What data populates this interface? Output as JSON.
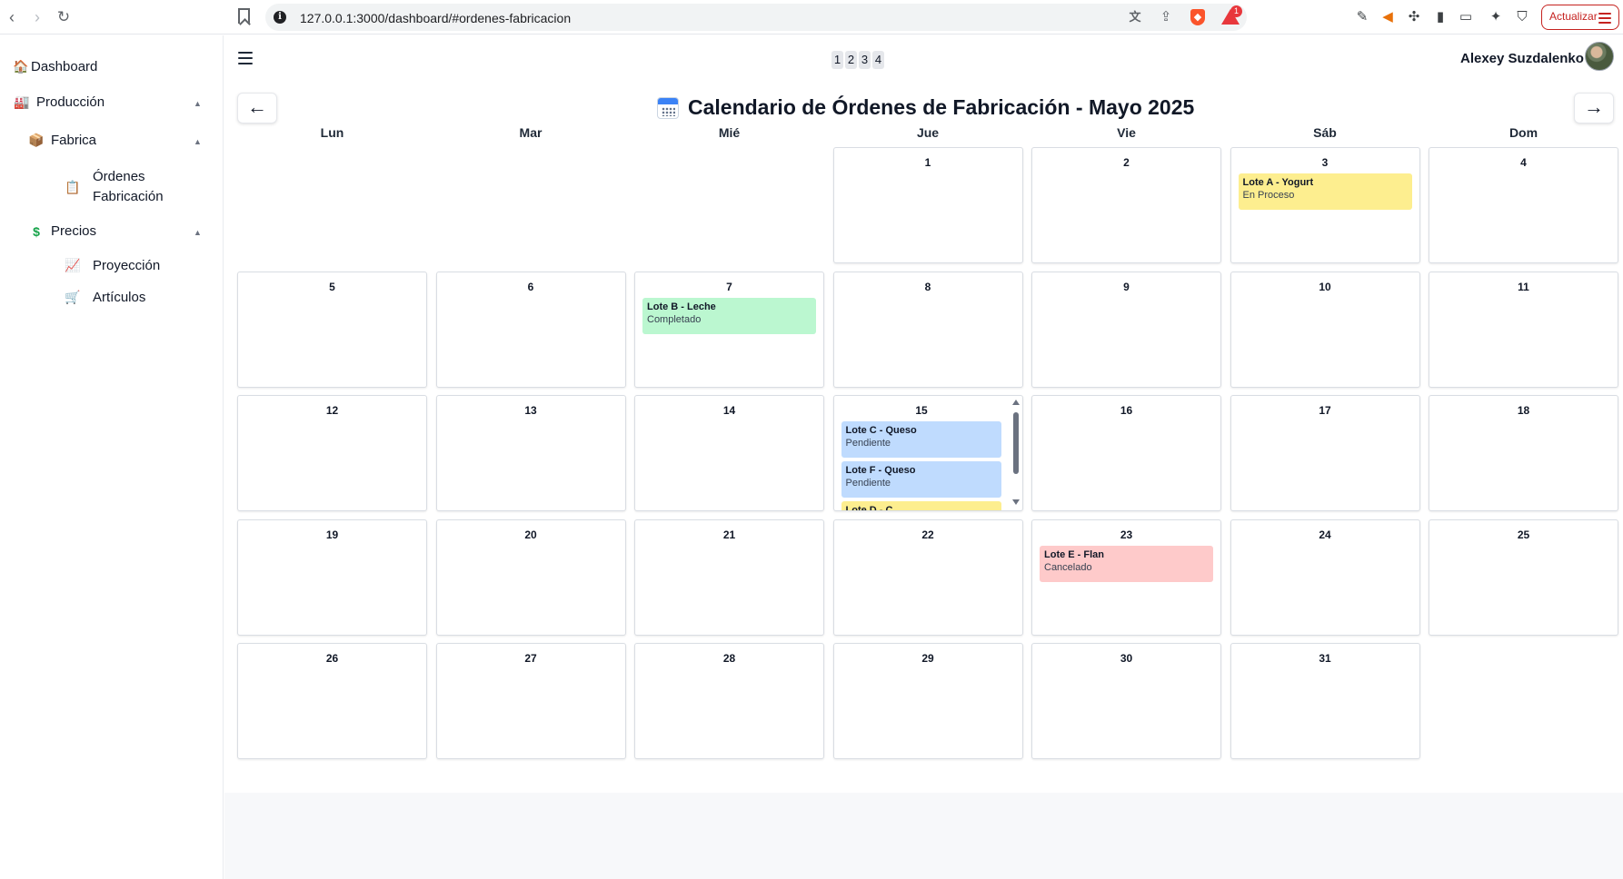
{
  "browser": {
    "url": "127.0.0.1:3000/dashboard/#ordenes-fabricacion",
    "update_label": "Actualizar",
    "rewards_badge": "1"
  },
  "sidebar": {
    "dashboard": "Dashboard",
    "produccion": "Producción",
    "fabrica": "Fabrica",
    "ordenes": "Órdenes Fabricación",
    "precios": "Precios",
    "proyeccion": "Proyección",
    "articulos": "Artículos",
    "icons": {
      "dashboard": "house-icon",
      "produccion": "factory-icon",
      "fabrica": "package-icon",
      "ordenes": "clipboard-icon",
      "precios": "dollar-icon",
      "proyeccion": "chart-icon",
      "articulos": "cart-icon"
    }
  },
  "header": {
    "pager": [
      "1",
      "2",
      "3",
      "4"
    ],
    "user_name": "Alexey Suzdalenko"
  },
  "calendar": {
    "title": "Calendario de Órdenes de Fabricación - Mayo 2025",
    "prev_label": "←",
    "next_label": "→",
    "weekdays": [
      "Lun",
      "Mar",
      "Mié",
      "Jue",
      "Vie",
      "Sáb",
      "Dom"
    ],
    "first_weekday_index": 3,
    "days_in_month": 31,
    "events": [
      {
        "day": 3,
        "title": "Lote A - Yogurt",
        "status": "En Proceso",
        "color": "#fdee8f"
      },
      {
        "day": 7,
        "title": "Lote B - Leche",
        "status": "Completado",
        "color": "#bbf7d0"
      },
      {
        "day": 15,
        "title": "Lote C - Queso",
        "status": "Pendiente",
        "color": "#bfdbfe"
      },
      {
        "day": 15,
        "title": "Lote F - Queso",
        "status": "Pendiente",
        "color": "#bfdbfe"
      },
      {
        "day": 15,
        "title": "Lote D - C",
        "status": "",
        "color": "#fdee8f"
      },
      {
        "day": 23,
        "title": "Lote E - Flan",
        "status": "Cancelado",
        "color": "#fecaca"
      }
    ]
  }
}
